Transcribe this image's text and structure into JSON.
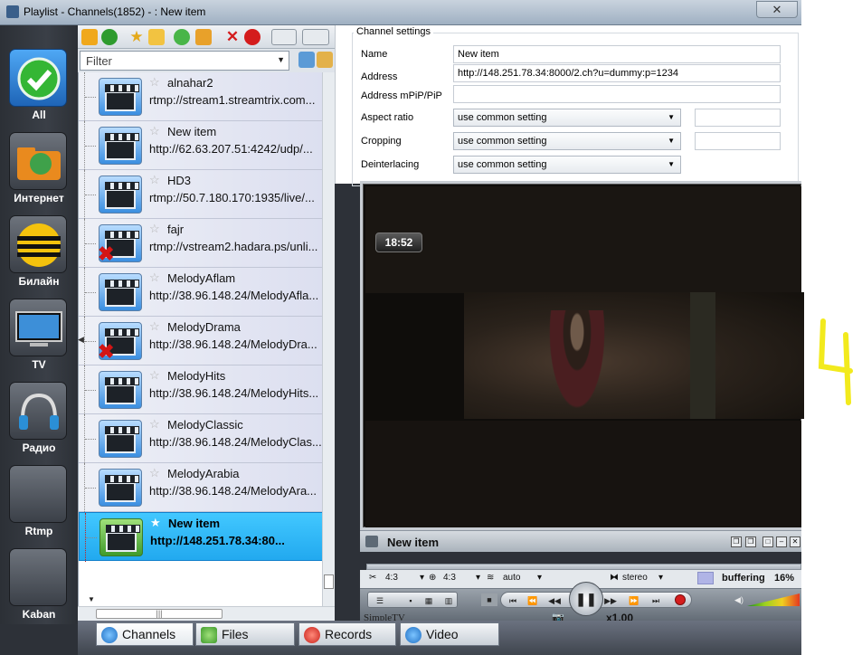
{
  "window": {
    "title": "Playlist - Channels(1852) -  : New item",
    "close_symbol": "✕"
  },
  "categories": [
    {
      "label": "All",
      "icon": "checkmark-icon"
    },
    {
      "label": "Интернет",
      "icon": "folder-globe-icon"
    },
    {
      "label": "Билайн",
      "icon": "beeline-logo-icon"
    },
    {
      "label": "TV",
      "icon": "tv-icon"
    },
    {
      "label": "Радио",
      "icon": "headphones-icon"
    },
    {
      "label": "Rtmp",
      "icon": "blank-tile-icon"
    },
    {
      "label": "Kaban",
      "icon": "blank-tile-icon"
    }
  ],
  "filter": {
    "placeholder": "Filter"
  },
  "playlist": [
    {
      "name": "alnahar2",
      "address": "rtmp://stream1.streamtrix.com...",
      "error": false
    },
    {
      "name": "New item",
      "address": "http://62.63.207.51:4242/udp/...",
      "error": false
    },
    {
      "name": "HD3",
      "address": "rtmp://50.7.180.170:1935/live/...",
      "error": false
    },
    {
      "name": "fajr",
      "address": "rtmp://vstream2.hadara.ps/unli...",
      "error": true
    },
    {
      "name": "MelodyAflam",
      "address": "http://38.96.148.24/MelodyAfla...",
      "error": false
    },
    {
      "name": "MelodyDrama",
      "address": "http://38.96.148.24/MelodyDra...",
      "error": true
    },
    {
      "name": "MelodyHits",
      "address": "http://38.96.148.24/MelodyHits...",
      "error": false
    },
    {
      "name": "MelodyClassic",
      "address": "http://38.96.148.24/MelodyClas...",
      "error": false
    },
    {
      "name": "MelodyArabia",
      "address": "http://38.96.148.24/MelodyAra...",
      "error": false
    },
    {
      "name": "New item",
      "address": "http://148.251.78.34:80...",
      "error": false,
      "selected": true
    }
  ],
  "settings": {
    "title": "Channel settings",
    "name_label": "Name",
    "name_value": "New item",
    "address_label": "Address",
    "address_value": "http://148.251.78.34:8000/2.ch?u=dummy:p=1234",
    "pip_label": "Address mPiP/PiP",
    "pip_value": "",
    "aspect_label": "Aspect ratio",
    "aspect_value": "use common setting",
    "crop_label": "Cropping",
    "crop_value": "use common setting",
    "deint_label": "Deinterlacing",
    "deint_value": "use common setting"
  },
  "player": {
    "clock": "18:52",
    "title": "New item",
    "aspect1": "4:3",
    "aspect2": "4:3",
    "audio": "auto",
    "sound_mode": "stereo",
    "buffering_label": "buffering",
    "buffering_value": "16%",
    "brand": "SimpleTV",
    "speed": "x1.00"
  },
  "tabs": [
    {
      "label": "Channels",
      "active": true
    },
    {
      "label": "Files",
      "active": false
    },
    {
      "label": "Records",
      "active": false
    },
    {
      "label": "Video",
      "active": false
    }
  ],
  "colors": {
    "selected_row": "#22a9ef",
    "accent_green": "#4caf2a",
    "error_red": "#d31515"
  }
}
